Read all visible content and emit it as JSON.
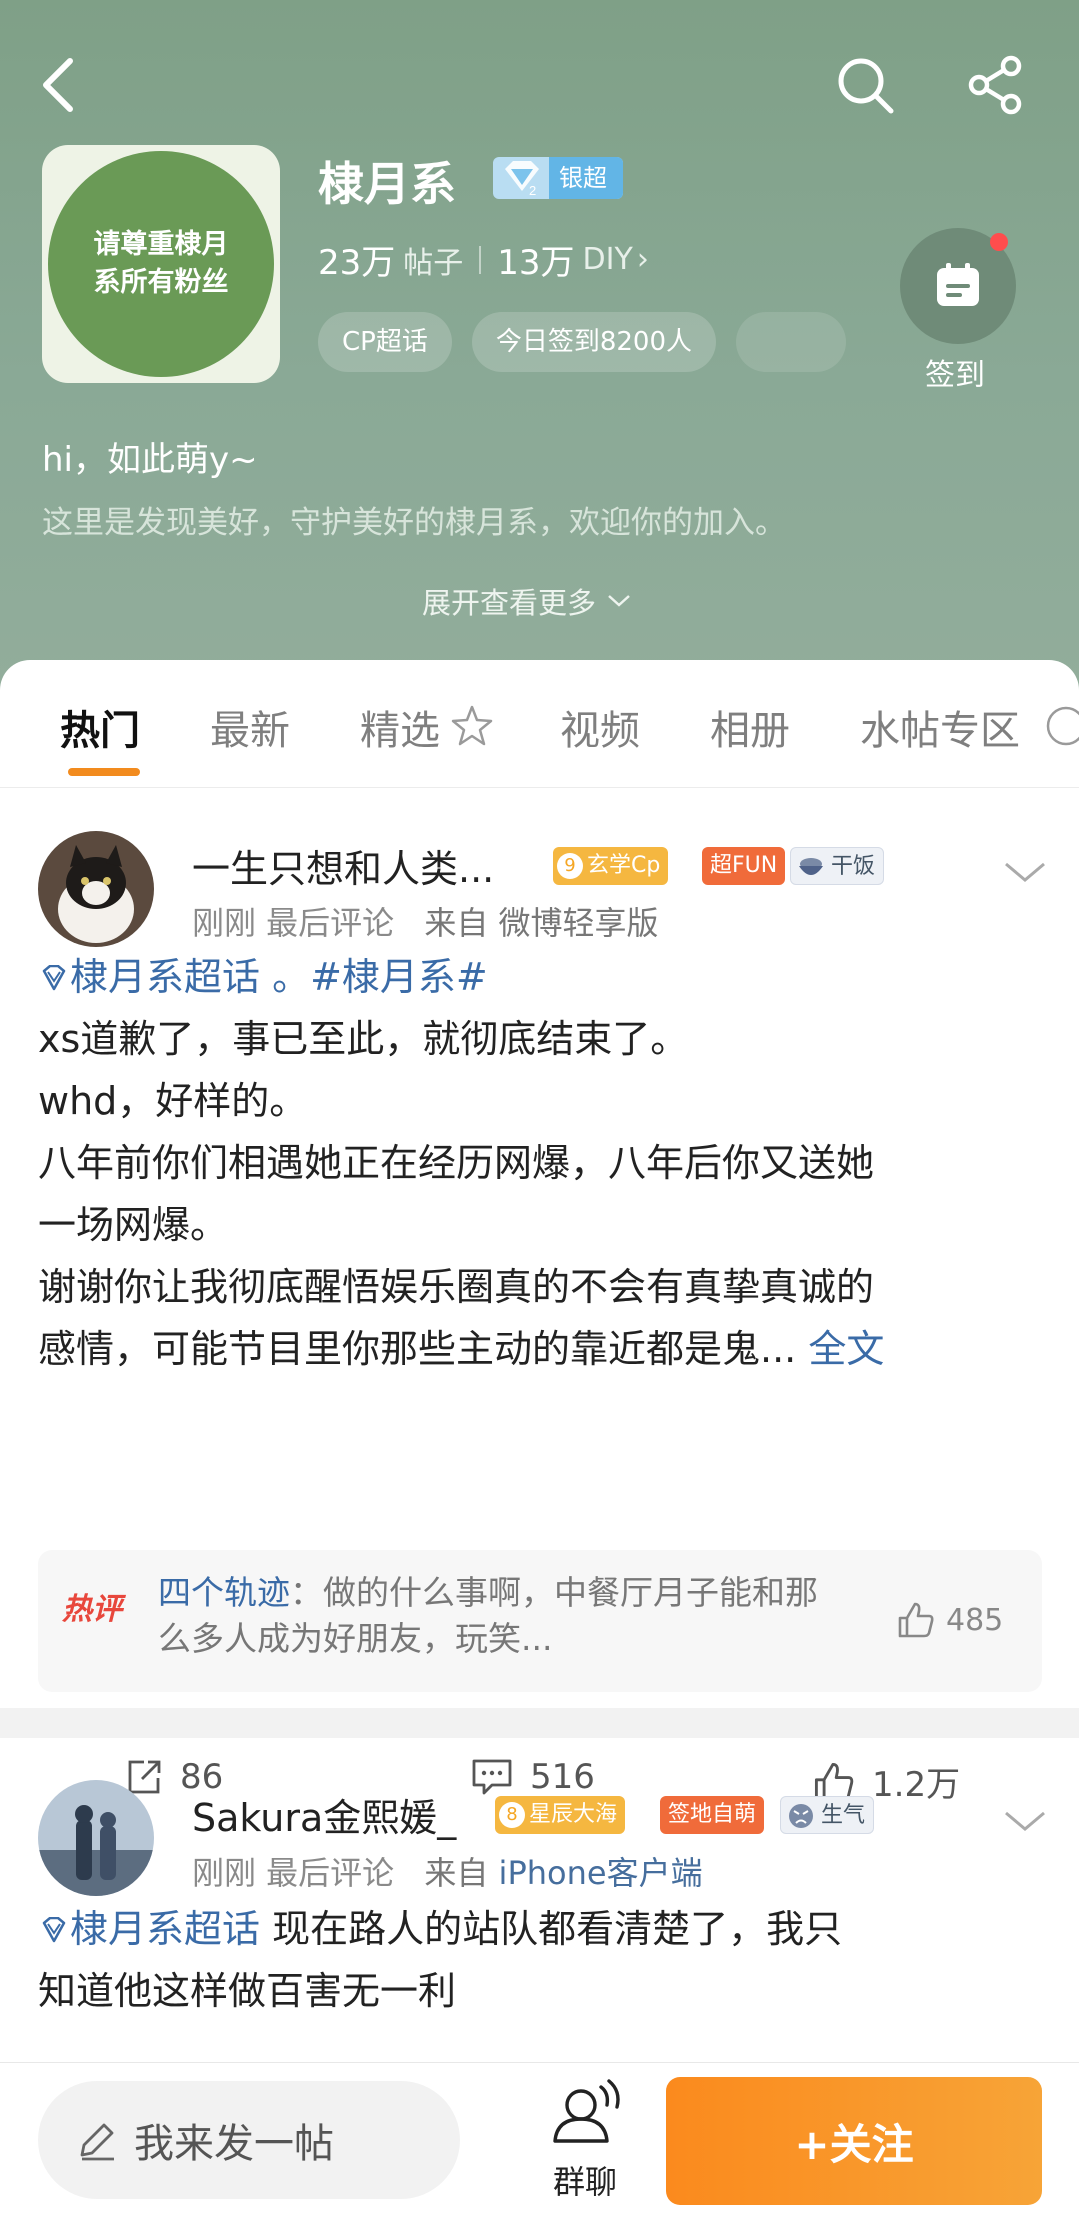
{
  "header": {
    "avatar_text_line1": "请尊重棣月",
    "avatar_text_line2": "系所有粉丝",
    "group_name": "棣月系",
    "level_label": "银超",
    "posts_count": "23万",
    "posts_label": "帖子",
    "diy_count": "13万",
    "diy_label": "DIY",
    "chips": [
      "CP超话",
      "今日签到8200人"
    ],
    "checkin_label": "签到",
    "greeting": "hi，如此萌y~",
    "description": "这里是发现美好，守护美好的棣月系，欢迎你的加入。",
    "expand_label": "展开查看更多"
  },
  "tabs": [
    "热门",
    "最新",
    "精选",
    "视频",
    "相册",
    "水帖专区"
  ],
  "posts": [
    {
      "user": "一生只想和人类...",
      "badges": [
        "玄学Cp",
        "超FUN",
        "干饭"
      ],
      "level_num": "9",
      "meta_time": "刚刚 最后评论",
      "meta_from": "来自",
      "meta_source": "微博轻享版",
      "topic": "棣月系超话",
      "body_after_topic": " 。#棣月系#",
      "lines": [
        "xs道歉了，事已至此，就彻底结束了。",
        "whd，好样的。",
        "八年前你们相遇她正在经历网爆，八年后你又送她",
        "一场网爆。",
        "谢谢你让我彻底醒悟娱乐圈真的不会有真挚真诚的",
        "感情，可能节目里你那些主动的靠近都是鬼..."
      ],
      "more_label": "全文",
      "hot_tag": "热评",
      "hot_user": "四个轨迹",
      "hot_text": "：做的什么事啊，中餐厅月子能和那么多人成为好朋友，玩笑...",
      "hot_likes": "485",
      "reposts": "86",
      "comments": "516",
      "likes": "1.2万"
    },
    {
      "user": "Sakura金熙媛_",
      "badges": [
        "星辰大海",
        "签地自萌",
        "生气"
      ],
      "level_num": "8",
      "meta_time": "刚刚 最后评论",
      "meta_from": "来自",
      "meta_source": "iPhone客户端",
      "topic": "棣月系超话",
      "body_after_topic": "  现在路人的站队都看清楚了，我只",
      "line2": "知道他这样做百害无一利"
    }
  ],
  "bottom": {
    "compose_label": "我来发一帖",
    "group_chat_label": "群聊",
    "follow_label": "+关注"
  },
  "colors": {
    "header_green": "#8aa996",
    "accent_orange": "#f28b1e",
    "link_blue": "#3a6ba7",
    "hot_red": "#e8473c"
  }
}
